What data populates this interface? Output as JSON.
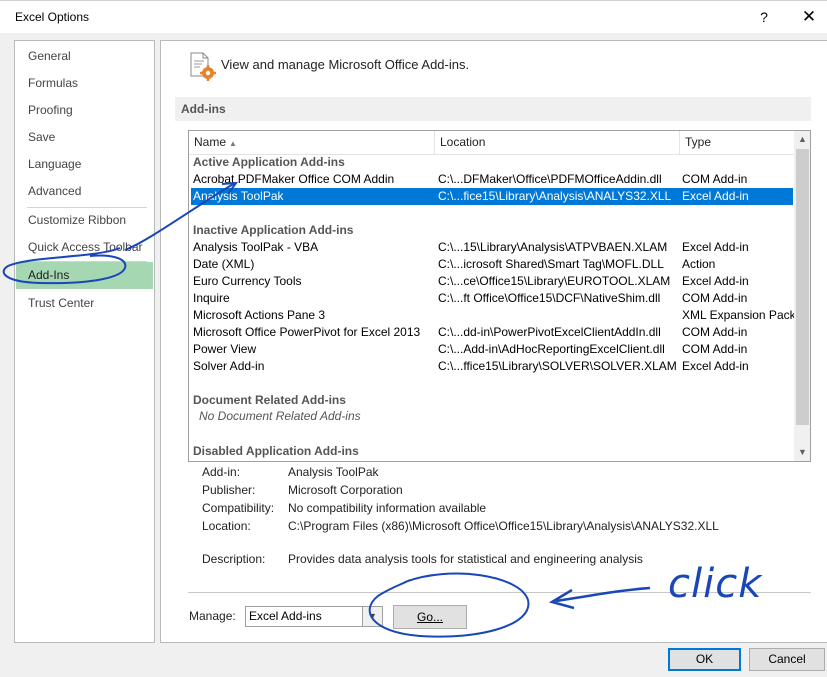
{
  "window": {
    "title": "Excel Options",
    "help": "?",
    "close": "✕"
  },
  "nav": {
    "items": [
      {
        "label": "General"
      },
      {
        "label": "Formulas"
      },
      {
        "label": "Proofing"
      },
      {
        "label": "Save"
      },
      {
        "label": "Language"
      },
      {
        "label": "Advanced"
      },
      {
        "label": "Customize Ribbon"
      },
      {
        "label": "Quick Access Toolbar"
      },
      {
        "label": "Add-Ins"
      },
      {
        "label": "Trust Center"
      }
    ],
    "active": "Add-Ins"
  },
  "header": {
    "text": "View and manage Microsoft Office Add-ins.",
    "icon": "addins-gear-icon"
  },
  "section": {
    "title": "Add-ins"
  },
  "table": {
    "columns": {
      "name": "Name",
      "location": "Location",
      "type": "Type",
      "sort_indicator": "▲"
    },
    "groups": {
      "active": "Active Application Add-ins",
      "inactive": "Inactive Application Add-ins",
      "document": "Document Related Add-ins",
      "disabled": "Disabled Application Add-ins"
    },
    "active_rows": [
      {
        "name": "Acrobat PDFMaker Office COM Addin",
        "location": "C:\\...DFMaker\\Office\\PDFMOfficeAddin.dll",
        "type": "COM Add-in"
      },
      {
        "name": "Analysis ToolPak",
        "location": "C:\\...fice15\\Library\\Analysis\\ANALYS32.XLL",
        "type": "Excel Add-in"
      }
    ],
    "inactive_rows": [
      {
        "name": "Analysis ToolPak - VBA",
        "location": "C:\\...15\\Library\\Analysis\\ATPVBAEN.XLAM",
        "type": "Excel Add-in"
      },
      {
        "name": "Date (XML)",
        "location": "C:\\...icrosoft Shared\\Smart Tag\\MOFL.DLL",
        "type": "Action"
      },
      {
        "name": "Euro Currency Tools",
        "location": "C:\\...ce\\Office15\\Library\\EUROTOOL.XLAM",
        "type": "Excel Add-in"
      },
      {
        "name": "Inquire",
        "location": "C:\\...ft Office\\Office15\\DCF\\NativeShim.dll",
        "type": "COM Add-in"
      },
      {
        "name": "Microsoft Actions Pane 3",
        "location": "",
        "type": "XML Expansion Pack"
      },
      {
        "name": "Microsoft Office PowerPivot for Excel 2013",
        "location": "C:\\...dd-in\\PowerPivotExcelClientAddIn.dll",
        "type": "COM Add-in"
      },
      {
        "name": "Power View",
        "location": "C:\\...Add-in\\AdHocReportingExcelClient.dll",
        "type": "COM Add-in"
      },
      {
        "name": "Solver Add-in",
        "location": "C:\\...ffice15\\Library\\SOLVER\\SOLVER.XLAM",
        "type": "Excel Add-in"
      }
    ],
    "document_empty": "No Document Related Add-ins",
    "selected": "Analysis ToolPak"
  },
  "details": {
    "addin_label": "Add-in:",
    "addin_value": "Analysis ToolPak",
    "publisher_label": "Publisher:",
    "publisher_value": "Microsoft Corporation",
    "compat_label": "Compatibility:",
    "compat_value": "No compatibility information available",
    "location_label": "Location:",
    "location_value": "C:\\Program Files (x86)\\Microsoft Office\\Office15\\Library\\Analysis\\ANALYS32.XLL",
    "description_label": "Description:",
    "description_value": "Provides data analysis tools for statistical and engineering analysis"
  },
  "manage": {
    "label": "Manage:",
    "selected": "Excel Add-ins",
    "go_label": "Go..."
  },
  "footer": {
    "ok": "OK",
    "cancel": "Cancel"
  },
  "annotation": {
    "text": "click",
    "color": "#1a47b8"
  },
  "colors": {
    "accent": "#0078d7",
    "nav_active": "#a5d7b2"
  }
}
